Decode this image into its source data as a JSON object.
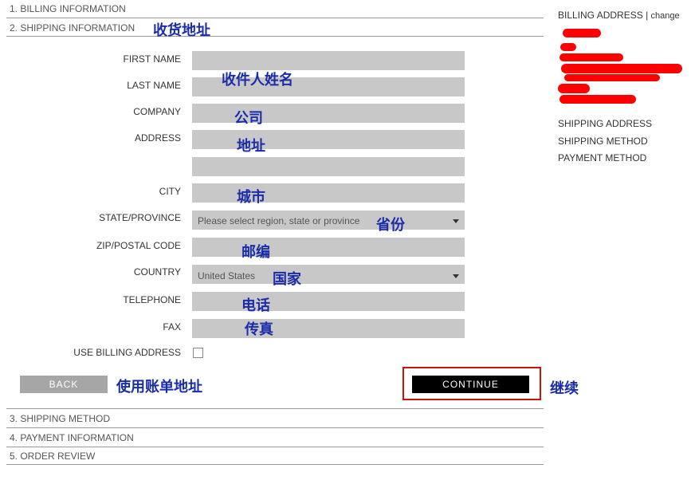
{
  "steps": {
    "billing": "1. BILLING INFORMATION",
    "shipping": "2. SHIPPING INFORMATION",
    "method": "3. SHIPPING METHOD",
    "payment": "4. PAYMENT INFORMATION",
    "review": "5. ORDER REVIEW"
  },
  "form": {
    "first_name": "FIRST NAME",
    "last_name": "LAST NAME",
    "company": "COMPANY",
    "address": "ADDRESS",
    "city": "CITY",
    "state": "STATE/PROVINCE",
    "state_placeholder": "Please select region, state or province",
    "zip": "ZIP/POSTAL CODE",
    "country": "COUNTRY",
    "country_value": "United States",
    "telephone": "TELEPHONE",
    "fax": "FAX",
    "use_billing": "USE BILLING ADDRESS",
    "use_billing_checked": false
  },
  "buttons": {
    "back": "BACK",
    "continue": "CONTINUE"
  },
  "annotations": {
    "shipping_address": "收货地址",
    "recipient_name": "收件人姓名",
    "company": "公司",
    "address": "地址",
    "city": "城市",
    "province": "省份",
    "zip": "邮编",
    "country": "国家",
    "phone": "电话",
    "fax": "传真",
    "use_billing": "使用账单地址",
    "continue": "继续"
  },
  "sidebar": {
    "billing_address": "BILLING ADDRESS",
    "separator": "|",
    "change": "change",
    "shipping_address": "SHIPPING ADDRESS",
    "shipping_method": "SHIPPING METHOD",
    "payment_method": "PAYMENT METHOD"
  },
  "colors": {
    "field_bg": "#c8c8c8",
    "continue_bg": "#000000",
    "back_bg": "#a6a6a6",
    "annotation": "#1a2ca8",
    "highlight_box": "#cc1111",
    "redaction": "#ff0000"
  }
}
